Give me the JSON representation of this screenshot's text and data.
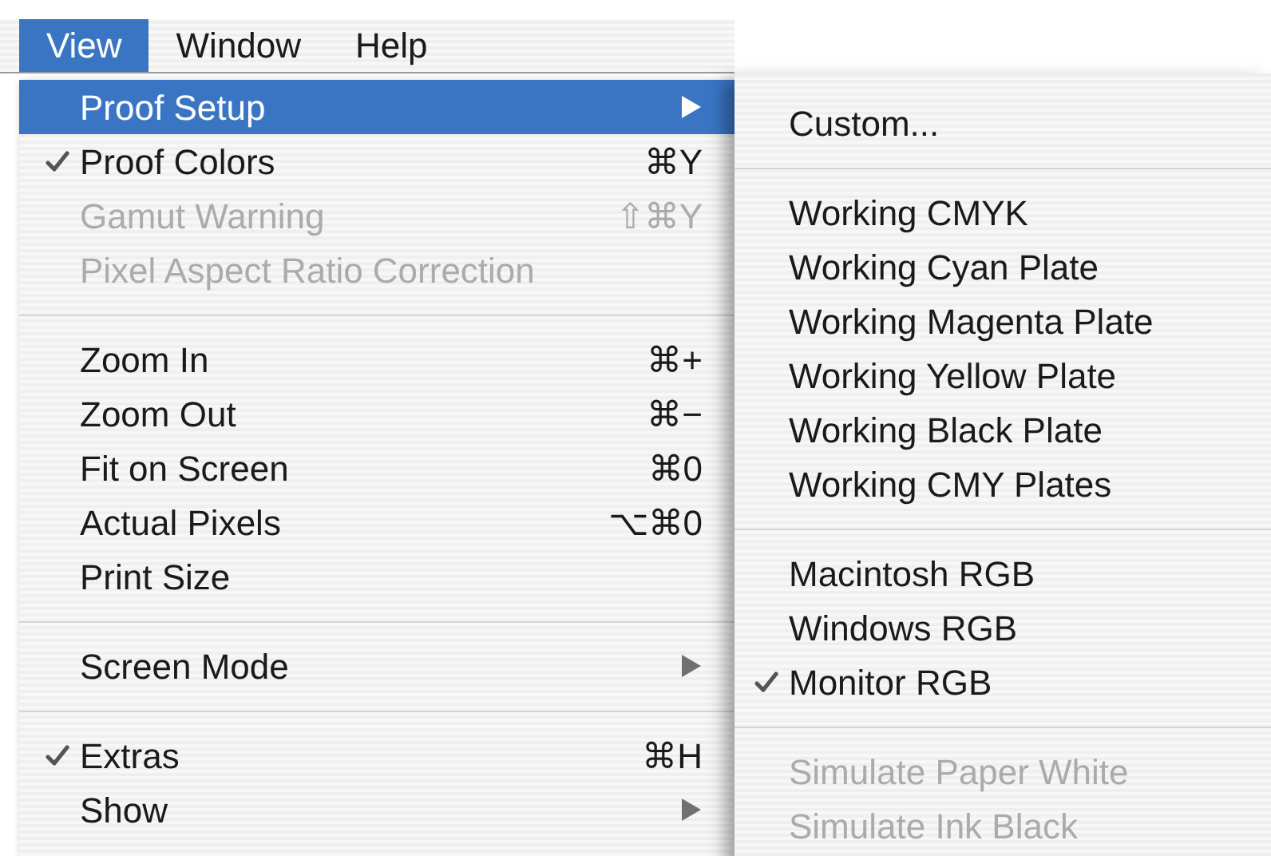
{
  "menubar": [
    {
      "label": "View",
      "selected": true
    },
    {
      "label": "Window",
      "selected": false
    },
    {
      "label": "Help",
      "selected": false
    }
  ],
  "view_menu": [
    {
      "kind": "item",
      "label": "Proof Setup",
      "selected": true,
      "checked": false,
      "disabled": false,
      "has_submenu": true
    },
    {
      "kind": "item",
      "label": "Proof Colors",
      "selected": false,
      "checked": true,
      "disabled": false,
      "shortcut": "⌘Y"
    },
    {
      "kind": "item",
      "label": "Gamut Warning",
      "selected": false,
      "checked": false,
      "disabled": true,
      "shortcut": "⇧⌘Y"
    },
    {
      "kind": "item",
      "label": "Pixel Aspect Ratio Correction",
      "selected": false,
      "checked": false,
      "disabled": true
    },
    {
      "kind": "separator"
    },
    {
      "kind": "item",
      "label": "Zoom In",
      "selected": false,
      "checked": false,
      "disabled": false,
      "shortcut": "⌘+"
    },
    {
      "kind": "item",
      "label": "Zoom Out",
      "selected": false,
      "checked": false,
      "disabled": false,
      "shortcut": "⌘−"
    },
    {
      "kind": "item",
      "label": "Fit on Screen",
      "selected": false,
      "checked": false,
      "disabled": false,
      "shortcut": "⌘0"
    },
    {
      "kind": "item",
      "label": "Actual Pixels",
      "selected": false,
      "checked": false,
      "disabled": false,
      "shortcut": "⌥⌘0"
    },
    {
      "kind": "item",
      "label": "Print Size",
      "selected": false,
      "checked": false,
      "disabled": false
    },
    {
      "kind": "separator"
    },
    {
      "kind": "item",
      "label": "Screen Mode",
      "selected": false,
      "checked": false,
      "disabled": false,
      "has_submenu": true
    },
    {
      "kind": "separator"
    },
    {
      "kind": "item",
      "label": "Extras",
      "selected": false,
      "checked": true,
      "disabled": false,
      "shortcut": "⌘H"
    },
    {
      "kind": "item",
      "label": "Show",
      "selected": false,
      "checked": false,
      "disabled": false,
      "has_submenu": true
    }
  ],
  "proof_setup_submenu": [
    {
      "kind": "item",
      "label": "Custom...",
      "selected": false,
      "checked": false,
      "disabled": false
    },
    {
      "kind": "separator"
    },
    {
      "kind": "item",
      "label": "Working CMYK",
      "selected": false,
      "checked": false,
      "disabled": false
    },
    {
      "kind": "item",
      "label": "Working Cyan Plate",
      "selected": false,
      "checked": false,
      "disabled": false
    },
    {
      "kind": "item",
      "label": "Working Magenta Plate",
      "selected": false,
      "checked": false,
      "disabled": false
    },
    {
      "kind": "item",
      "label": "Working Yellow Plate",
      "selected": false,
      "checked": false,
      "disabled": false
    },
    {
      "kind": "item",
      "label": "Working Black Plate",
      "selected": false,
      "checked": false,
      "disabled": false
    },
    {
      "kind": "item",
      "label": "Working CMY Plates",
      "selected": false,
      "checked": false,
      "disabled": false
    },
    {
      "kind": "separator"
    },
    {
      "kind": "item",
      "label": "Macintosh RGB",
      "selected": false,
      "checked": false,
      "disabled": false
    },
    {
      "kind": "item",
      "label": "Windows RGB",
      "selected": false,
      "checked": false,
      "disabled": false
    },
    {
      "kind": "item",
      "label": "Monitor RGB",
      "selected": false,
      "checked": true,
      "disabled": false
    },
    {
      "kind": "separator"
    },
    {
      "kind": "item",
      "label": "Simulate Paper White",
      "selected": false,
      "checked": false,
      "disabled": true
    },
    {
      "kind": "item",
      "label": "Simulate Ink Black",
      "selected": false,
      "checked": false,
      "disabled": true
    }
  ]
}
